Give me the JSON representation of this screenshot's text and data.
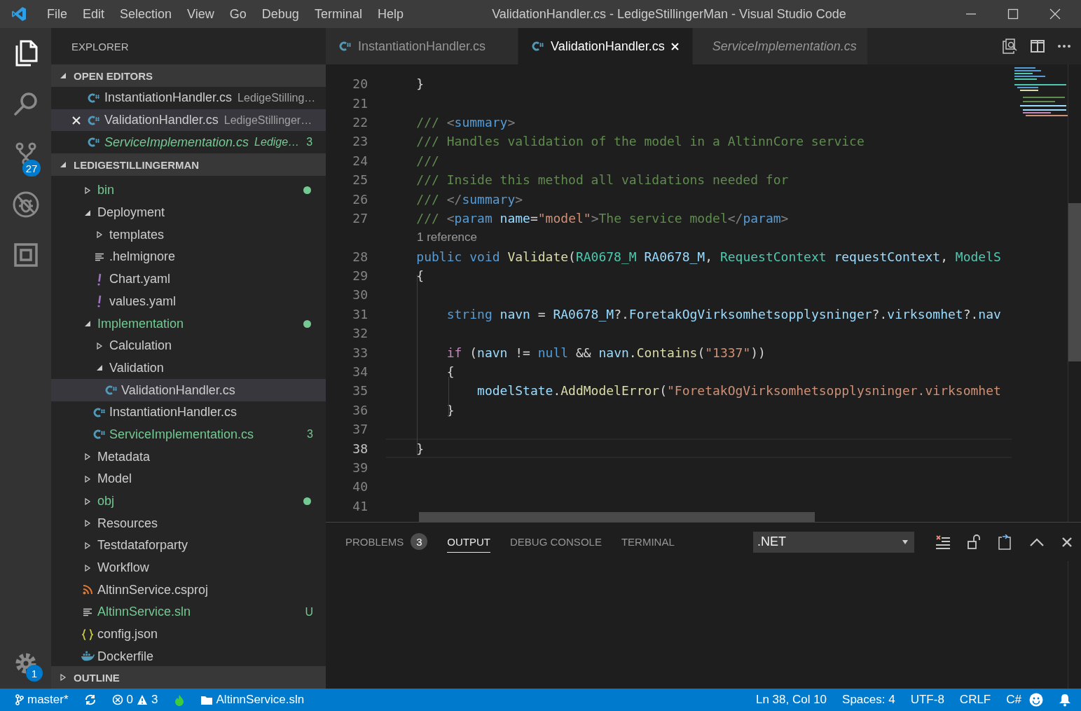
{
  "window": {
    "title": "ValidationHandler.cs - LedigeStillingerMan - Visual Studio Code",
    "menu": [
      "File",
      "Edit",
      "Selection",
      "View",
      "Go",
      "Debug",
      "Terminal",
      "Help"
    ]
  },
  "activity_bar": {
    "items": [
      {
        "kind": "files",
        "selected": true
      },
      {
        "kind": "search",
        "selected": false
      },
      {
        "kind": "source-control",
        "selected": false,
        "badge": "27"
      },
      {
        "kind": "debug",
        "selected": false
      },
      {
        "kind": "extensions",
        "selected": false
      }
    ],
    "settings_badge": "1"
  },
  "sidebar": {
    "title": "EXPLORER",
    "open_editors": {
      "title": "OPEN EDITORS",
      "expanded": true,
      "items": [
        {
          "name": "InstantiationHandler.cs",
          "description": "LedigeStilling…",
          "preview": false,
          "selected": false
        },
        {
          "name": "ValidationHandler.cs",
          "description": "LedigeStillinger…",
          "preview": false,
          "selected": true
        },
        {
          "name": "ServiceImplementation.cs",
          "description": "Ledige…",
          "preview": true,
          "selected": false,
          "color": "#73c991",
          "badge": "3"
        }
      ]
    },
    "project": {
      "title": "LEDIGESTILLINGERMAN",
      "expanded": true,
      "items": [
        {
          "name": "bin",
          "kind": "folder",
          "expanded": false,
          "color": "#73c991",
          "dot": true
        },
        {
          "name": "Deployment",
          "kind": "folder",
          "expanded": true,
          "children": [
            {
              "name": "templates",
              "kind": "folder",
              "expanded": false
            },
            {
              "name": ".helmignore",
              "kind": "lines"
            },
            {
              "name": "Chart.yaml",
              "kind": "yaml"
            },
            {
              "name": "values.yaml",
              "kind": "yaml"
            }
          ]
        },
        {
          "name": "Implementation",
          "kind": "folder",
          "expanded": true,
          "color": "#73c991",
          "dot": true,
          "children": [
            {
              "name": "Calculation",
              "kind": "folder",
              "expanded": false
            },
            {
              "name": "Validation",
              "kind": "folder",
              "expanded": true,
              "children": [
                {
                  "name": "ValidationHandler.cs",
                  "kind": "csharp",
                  "selected": true
                }
              ]
            },
            {
              "name": "InstantiationHandler.cs",
              "kind": "csharp"
            },
            {
              "name": "ServiceImplementation.cs",
              "kind": "csharp",
              "color": "#73c991",
              "badge": "3"
            }
          ]
        },
        {
          "name": "Metadata",
          "kind": "folder",
          "expanded": false
        },
        {
          "name": "Model",
          "kind": "folder",
          "expanded": false
        },
        {
          "name": "obj",
          "kind": "folder",
          "expanded": false,
          "color": "#73c991",
          "dot": true
        },
        {
          "name": "Resources",
          "kind": "folder",
          "expanded": false
        },
        {
          "name": "Testdataforparty",
          "kind": "folder",
          "expanded": false
        },
        {
          "name": "Workflow",
          "kind": "folder",
          "expanded": false
        },
        {
          "name": "AltinnService.csproj",
          "kind": "csproj"
        },
        {
          "name": "AltinnService.sln",
          "kind": "lines",
          "color": "#73c991",
          "badge": "U"
        },
        {
          "name": "config.json",
          "kind": "json"
        },
        {
          "name": "Dockerfile",
          "kind": "docker"
        }
      ]
    },
    "outline": {
      "title": "OUTLINE",
      "expanded": false
    }
  },
  "tabs": [
    {
      "label": "InstantiationHandler.cs",
      "selected": false,
      "preview": false
    },
    {
      "label": "ValidationHandler.cs",
      "selected": true,
      "preview": false
    },
    {
      "label": "ServiceImplementation.cs",
      "selected": false,
      "preview": true
    }
  ],
  "editor": {
    "lines": [
      {
        "kind": "code",
        "number": "20",
        "current": false,
        "tokens": [
          {
            "text": "    }",
            "kind": "plain"
          }
        ]
      },
      {
        "kind": "code",
        "number": "21",
        "current": false
      },
      {
        "kind": "code",
        "number": "22",
        "current": false,
        "tokens": [
          {
            "text": "    /// ",
            "kind": "comment"
          },
          {
            "text": "<",
            "kind": "tag"
          },
          {
            "text": "summary",
            "kind": "keyword"
          },
          {
            "text": ">",
            "kind": "tag"
          }
        ]
      },
      {
        "kind": "code",
        "number": "23",
        "current": false,
        "tokens": [
          {
            "text": "    /// Handles validation of the model in a AltinnCore service",
            "kind": "comment"
          }
        ]
      },
      {
        "kind": "code",
        "number": "24",
        "current": false,
        "tokens": [
          {
            "text": "    ///",
            "kind": "comment"
          }
        ]
      },
      {
        "kind": "code",
        "number": "25",
        "current": false,
        "tokens": [
          {
            "text": "    /// Inside this method all validations needed for",
            "kind": "comment"
          }
        ]
      },
      {
        "kind": "code",
        "number": "26",
        "current": false,
        "tokens": [
          {
            "text": "    /// ",
            "kind": "comment"
          },
          {
            "text": "</",
            "kind": "tag"
          },
          {
            "text": "summary",
            "kind": "keyword"
          },
          {
            "text": ">",
            "kind": "tag"
          }
        ]
      },
      {
        "kind": "code",
        "number": "27",
        "current": false,
        "tokens": [
          {
            "text": "    /// ",
            "kind": "comment"
          },
          {
            "text": "<",
            "kind": "tag"
          },
          {
            "text": "param ",
            "kind": "keyword"
          },
          {
            "text": "name",
            "kind": "variable"
          },
          {
            "text": "=",
            "kind": "plain"
          },
          {
            "text": "\"model\"",
            "kind": "string"
          },
          {
            "text": ">",
            "kind": "tag"
          },
          {
            "text": "The service model",
            "kind": "comment"
          },
          {
            "text": "</",
            "kind": "tag"
          },
          {
            "text": "param",
            "kind": "keyword"
          },
          {
            "text": ">",
            "kind": "tag"
          }
        ]
      },
      {
        "kind": "codelens",
        "text": "1 reference"
      },
      {
        "kind": "code",
        "number": "28",
        "current": false,
        "tokens": [
          {
            "text": "    public void ",
            "kind": "keyword"
          },
          {
            "text": "Validate",
            "kind": "function"
          },
          {
            "text": "(",
            "kind": "plain"
          },
          {
            "text": "RA0678_M ",
            "kind": "type"
          },
          {
            "text": "RA0678_M",
            "kind": "variable"
          },
          {
            "text": ", ",
            "kind": "plain"
          },
          {
            "text": "RequestContext ",
            "kind": "type"
          },
          {
            "text": "requestContext",
            "kind": "variable"
          },
          {
            "text": ", ",
            "kind": "plain"
          },
          {
            "text": "ModelS",
            "kind": "type"
          }
        ]
      },
      {
        "kind": "code",
        "number": "29",
        "current": false,
        "tokens": [
          {
            "text": "    {",
            "kind": "plain"
          }
        ]
      },
      {
        "kind": "code",
        "number": "30",
        "current": false
      },
      {
        "kind": "code",
        "number": "31",
        "current": false,
        "tokens": [
          {
            "text": "        string ",
            "kind": "keyword"
          },
          {
            "text": "navn",
            "kind": "variable"
          },
          {
            "text": " = ",
            "kind": "plain"
          },
          {
            "text": "RA0678_M",
            "kind": "variable"
          },
          {
            "text": "?.",
            "kind": "plain"
          },
          {
            "text": "ForetakOgVirksomhetsopplysninger",
            "kind": "variable"
          },
          {
            "text": "?.",
            "kind": "plain"
          },
          {
            "text": "virksomhet",
            "kind": "variable"
          },
          {
            "text": "?.",
            "kind": "plain"
          },
          {
            "text": "nav",
            "kind": "variable"
          }
        ]
      },
      {
        "kind": "code",
        "number": "32",
        "current": false
      },
      {
        "kind": "code",
        "number": "33",
        "current": false,
        "tokens": [
          {
            "text": "        if",
            "kind": "control"
          },
          {
            "text": " (",
            "kind": "plain"
          },
          {
            "text": "navn",
            "kind": "variable"
          },
          {
            "text": " != ",
            "kind": "plain"
          },
          {
            "text": "null",
            "kind": "keyword"
          },
          {
            "text": " && ",
            "kind": "plain"
          },
          {
            "text": "navn",
            "kind": "variable"
          },
          {
            "text": ".",
            "kind": "plain"
          },
          {
            "text": "Contains",
            "kind": "function"
          },
          {
            "text": "(",
            "kind": "plain"
          },
          {
            "text": "\"1337\"",
            "kind": "string"
          },
          {
            "text": "))",
            "kind": "plain"
          }
        ]
      },
      {
        "kind": "code",
        "number": "34",
        "current": false,
        "tokens": [
          {
            "text": "        {",
            "kind": "plain"
          }
        ]
      },
      {
        "kind": "code",
        "number": "35",
        "current": false,
        "tokens": [
          {
            "text": "            modelState",
            "kind": "variable"
          },
          {
            "text": ".",
            "kind": "plain"
          },
          {
            "text": "AddModelError",
            "kind": "function"
          },
          {
            "text": "(",
            "kind": "plain"
          },
          {
            "text": "\"ForetakOgVirksomhetsopplysninger.virksomhet",
            "kind": "string"
          }
        ]
      },
      {
        "kind": "code",
        "number": "36",
        "current": false,
        "tokens": [
          {
            "text": "        }",
            "kind": "plain"
          }
        ]
      },
      {
        "kind": "code",
        "number": "37",
        "current": false
      },
      {
        "kind": "code",
        "number": "38",
        "current": true,
        "tokens": [
          {
            "text": "    }",
            "kind": "plain"
          }
        ]
      },
      {
        "kind": "code",
        "number": "39",
        "current": false
      },
      {
        "kind": "code",
        "number": "40",
        "current": false
      },
      {
        "kind": "code",
        "number": "41",
        "current": false
      }
    ]
  },
  "panel": {
    "tabs": [
      {
        "label": "PROBLEMS",
        "selected": false,
        "badge": "3"
      },
      {
        "label": "OUTPUT",
        "selected": true
      },
      {
        "label": "DEBUG CONSOLE",
        "selected": false
      },
      {
        "label": "TERMINAL",
        "selected": false
      }
    ],
    "channel": ".NET"
  },
  "status_bar": {
    "left": [
      {
        "kind": "branch",
        "text": "master*"
      },
      {
        "kind": "sync"
      },
      {
        "kind": "problems",
        "errors": "0",
        "warnings": "3"
      },
      {
        "kind": "live"
      },
      {
        "kind": "folder",
        "text": "AltinnService.sln"
      }
    ],
    "right": [
      {
        "kind": "text",
        "text": "Ln 38, Col 10"
      },
      {
        "kind": "text",
        "text": "Spaces: 4"
      },
      {
        "kind": "text",
        "text": "UTF-8"
      },
      {
        "kind": "text",
        "text": "CRLF"
      },
      {
        "kind": "text",
        "text": "C#"
      },
      {
        "kind": "feedback"
      },
      {
        "kind": "bell"
      }
    ]
  }
}
